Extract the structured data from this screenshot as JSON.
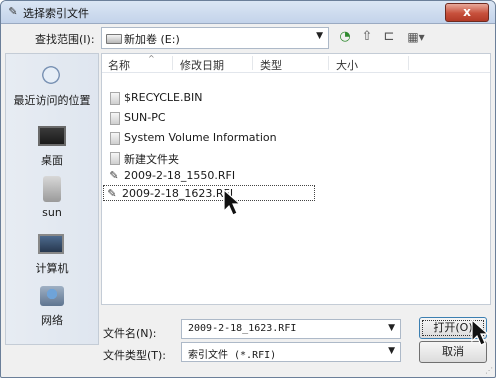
{
  "window": {
    "title": "选择索引文件",
    "close_glyph": "x"
  },
  "toolbar": {
    "look_in_label": "查找范围(I):",
    "look_in_value": "新加卷 (E:)",
    "buttons": [
      {
        "name": "back-icon",
        "glyph": "◔"
      },
      {
        "name": "up-folder-icon",
        "glyph": "⇧"
      },
      {
        "name": "new-folder-icon",
        "glyph": "⊏"
      },
      {
        "name": "view-menu-icon",
        "glyph": "▦▾"
      }
    ]
  },
  "sidebar": {
    "items": [
      {
        "label": "最近访问的位置",
        "icon": "recent-places-icon"
      },
      {
        "label": "桌面",
        "icon": "desktop-icon"
      },
      {
        "label": "sun",
        "icon": "user-folder-icon"
      },
      {
        "label": "计算机",
        "icon": "computer-icon"
      },
      {
        "label": "网络",
        "icon": "network-icon"
      }
    ]
  },
  "file_list": {
    "columns": [
      "名称",
      "修改日期",
      "类型",
      "大小"
    ],
    "sort_indicator": "^",
    "files": [
      {
        "name": "$RECYCLE.BIN",
        "icon": "folder-icon",
        "selected": false
      },
      {
        "name": "SUN-PC",
        "icon": "folder-icon",
        "selected": false
      },
      {
        "name": "System Volume Information",
        "icon": "folder-icon",
        "selected": false
      },
      {
        "name": "新建文件夹",
        "icon": "folder-icon",
        "selected": false
      },
      {
        "name": "2009-2-18_1550.RFI",
        "icon": "rfi-file-icon",
        "selected": false
      },
      {
        "name": "2009-2-18_1623.RFI",
        "icon": "rfi-file-icon",
        "selected": true
      }
    ]
  },
  "footer": {
    "filename_label": "文件名(N):",
    "filename_value": "2009-2-18_1623.RFI",
    "filetype_label": "文件类型(T):",
    "filetype_value": "索引文件 (*.RFI)",
    "open_label": "打开(O)",
    "cancel_label": "取消"
  }
}
